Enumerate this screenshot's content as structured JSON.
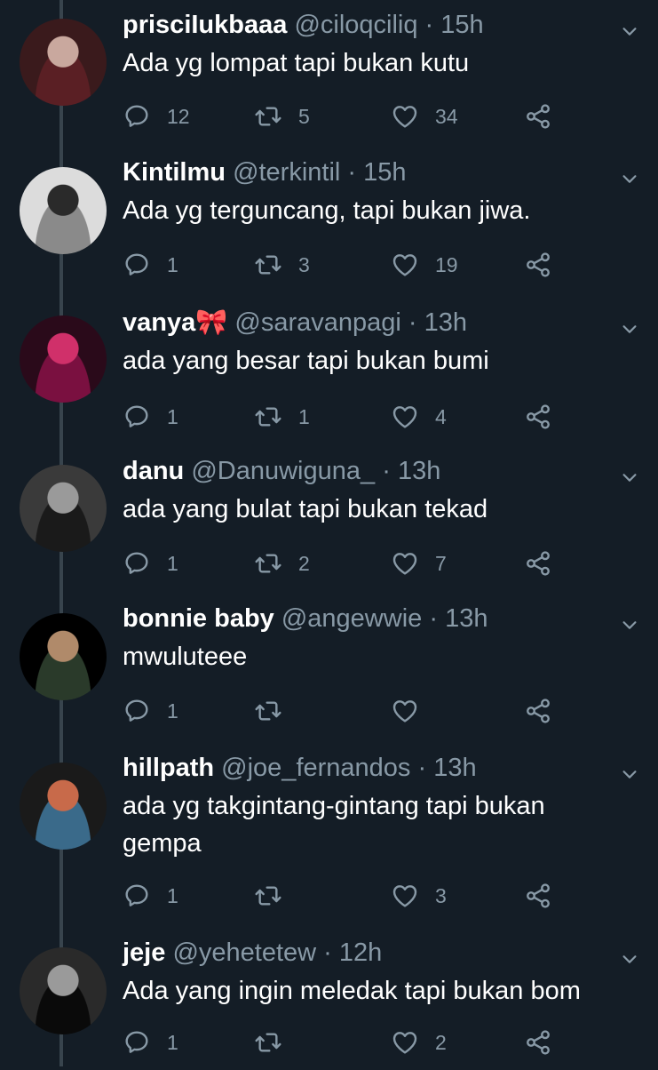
{
  "colors": {
    "background": "#141d26",
    "thread_line": "#38444d",
    "secondary_text": "#8899a6",
    "primary_text": "#ffffff"
  },
  "tweets": [
    {
      "name": "prisciIukbaaa",
      "handle": "@ciloqciliq",
      "dot": "·",
      "time": "15h",
      "text": "Ada yg lompat tapi bukan kutu",
      "replies": "12",
      "retweets": "5",
      "likes": "34",
      "avatar_colors": [
        "#3a1a1c",
        "#c9a89e",
        "#5a1f24"
      ]
    },
    {
      "name": "Kintilmu",
      "handle": "@terkintil",
      "dot": "·",
      "time": "15h",
      "text": "Ada yg terguncang, tapi bukan jiwa.",
      "replies": "1",
      "retweets": "3",
      "likes": "19",
      "avatar_colors": [
        "#dcdcdc",
        "#2a2a2a",
        "#8a8a8a"
      ]
    },
    {
      "name": "vanya🎀",
      "handle": "@saravanpagi",
      "dot": "·",
      "time": "13h",
      "text": "ada yang besar tapi bukan bumi",
      "replies": "1",
      "retweets": "1",
      "likes": "4",
      "avatar_colors": [
        "#2a0a1a",
        "#d0306a",
        "#7a1040"
      ]
    },
    {
      "name": "danu",
      "handle": "@Danuwiguna_",
      "dot": "·",
      "time": "13h",
      "text": "ada yang bulat tapi bukan tekad",
      "replies": "1",
      "retweets": "2",
      "likes": "7",
      "avatar_colors": [
        "#3a3a3a",
        "#9a9a9a",
        "#1a1a1a"
      ]
    },
    {
      "name": "bonnie baby",
      "handle": "@angewwie",
      "dot": "·",
      "time": "13h",
      "text": "mwuluteee",
      "replies": "1",
      "retweets": "",
      "likes": "",
      "avatar_colors": [
        "#000000",
        "#b08a6a",
        "#2a3a2a"
      ]
    },
    {
      "name": "hillpath",
      "handle": "@joe_fernandos",
      "dot": "·",
      "time": "13h",
      "text": "ada yg takgintang-gintang tapi bukan gempa",
      "replies": "1",
      "retweets": "",
      "likes": "3",
      "avatar_colors": [
        "#1a1a1a",
        "#c86a4a",
        "#3a6a8a"
      ]
    },
    {
      "name": "jeje",
      "handle": "@yehetetew",
      "dot": "·",
      "time": "12h",
      "text": "Ada yang ingin meledak tapi bukan bom",
      "replies": "1",
      "retweets": "",
      "likes": "2",
      "avatar_colors": [
        "#2a2a2a",
        "#9a9a9a",
        "#0a0a0a"
      ]
    }
  ],
  "icons": {
    "reply": "reply-icon",
    "retweet": "retweet-icon",
    "like": "heart-icon",
    "share": "share-icon",
    "menu": "chevron-down-icon"
  }
}
